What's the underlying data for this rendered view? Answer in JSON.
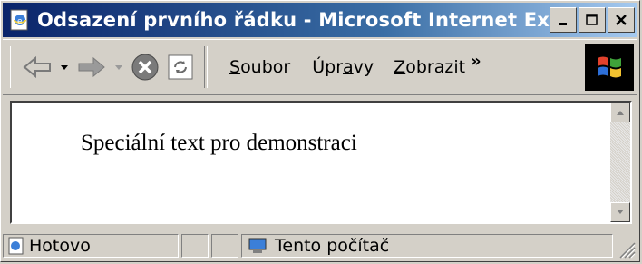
{
  "window": {
    "title": "Odsazení prvního řádku - Microsoft Internet Explor...",
    "title_icon": "ie-page-icon",
    "controls": [
      "minimize",
      "maximize",
      "close"
    ]
  },
  "toolbar": {
    "buttons": [
      {
        "name": "back",
        "icon": "back-arrow-icon"
      },
      {
        "name": "forward",
        "icon": "forward-arrow-icon"
      },
      {
        "name": "stop",
        "icon": "stop-icon"
      },
      {
        "name": "refresh",
        "icon": "refresh-icon"
      }
    ],
    "menu": {
      "soubor_prefix": "",
      "soubor_access": "S",
      "soubor_rest": "oubor",
      "upravy_prefix": "Úpr",
      "upravy_access": "a",
      "upravy_rest": "vy",
      "zobrazit_prefix": "",
      "zobrazit_access": "Z",
      "zobrazit_rest": "obrazit"
    },
    "overflow": "»"
  },
  "content": {
    "text": "Speciální text pro demonstraci"
  },
  "status": {
    "text": "Hotovo",
    "zone": "Tento počítač"
  },
  "colors": {
    "titlebar_start": "#0a246a",
    "titlebar_end": "#a6caf0",
    "chrome": "#d4d0c8",
    "stop": "#7a7a7a"
  }
}
